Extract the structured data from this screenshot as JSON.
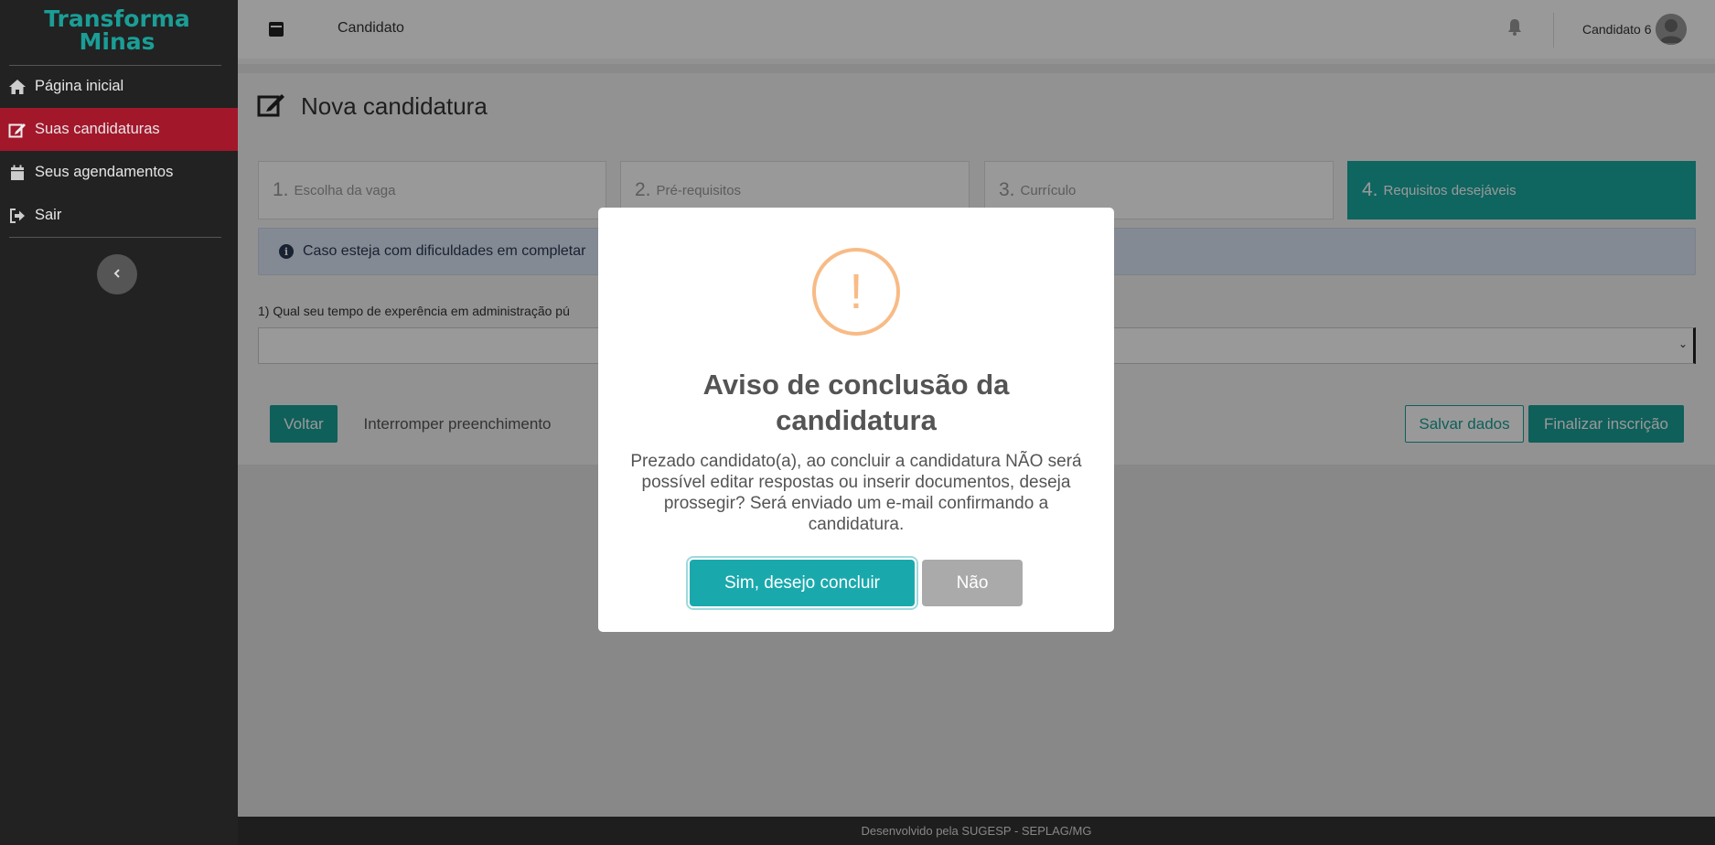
{
  "app": {
    "logo_line1": "Transforma",
    "logo_line2": "Minas",
    "brand_color": "#1a9e96",
    "active_color": "#a3172b"
  },
  "sidebar": {
    "items": [
      {
        "label": "Página inicial",
        "icon": "home-icon"
      },
      {
        "label": "Suas candidaturas",
        "icon": "edit-icon",
        "active": true
      },
      {
        "label": "Seus agendamentos",
        "icon": "calendar-icon"
      },
      {
        "label": "Sair",
        "icon": "sign-out-icon"
      }
    ],
    "collapse_icon": "chevron-left-icon"
  },
  "topbar": {
    "title": "Candidato",
    "user_name": "Candidato 6"
  },
  "main": {
    "title": "Nova candidatura",
    "steps": [
      {
        "num": "1.",
        "label": "Escolha da vaga"
      },
      {
        "num": "2.",
        "label": "Pré-requisitos"
      },
      {
        "num": "3.",
        "label": "Currículo"
      },
      {
        "num": "4.",
        "label": "Requisitos desejáveis",
        "active": true
      }
    ],
    "alert_text": "Caso esteja com dificuldades em completar",
    "question_label": "1) Qual seu tempo de experência em administração pú",
    "select_value": ""
  },
  "actions": {
    "back": "Voltar",
    "interrupt": "Interromper preenchimento",
    "save": "Salvar dados",
    "finish": "Finalizar inscrição"
  },
  "footer": {
    "text": "Desenvolvido pela SUGESP - SEPLAG/MG"
  },
  "modal": {
    "icon": "warning-icon",
    "icon_symbol": "!",
    "title_line1": "Aviso de conclusão da",
    "title_line2": "candidatura",
    "text_lines": [
      "Prezado candidato(a), ao concluir a candidatura NÃO será",
      "possível editar respostas ou inserir documentos, deseja",
      "prossegir? Será enviado um e-mail confirmando a",
      "candidatura."
    ],
    "confirm": "Sim, desejo concluir",
    "cancel": "Não"
  }
}
